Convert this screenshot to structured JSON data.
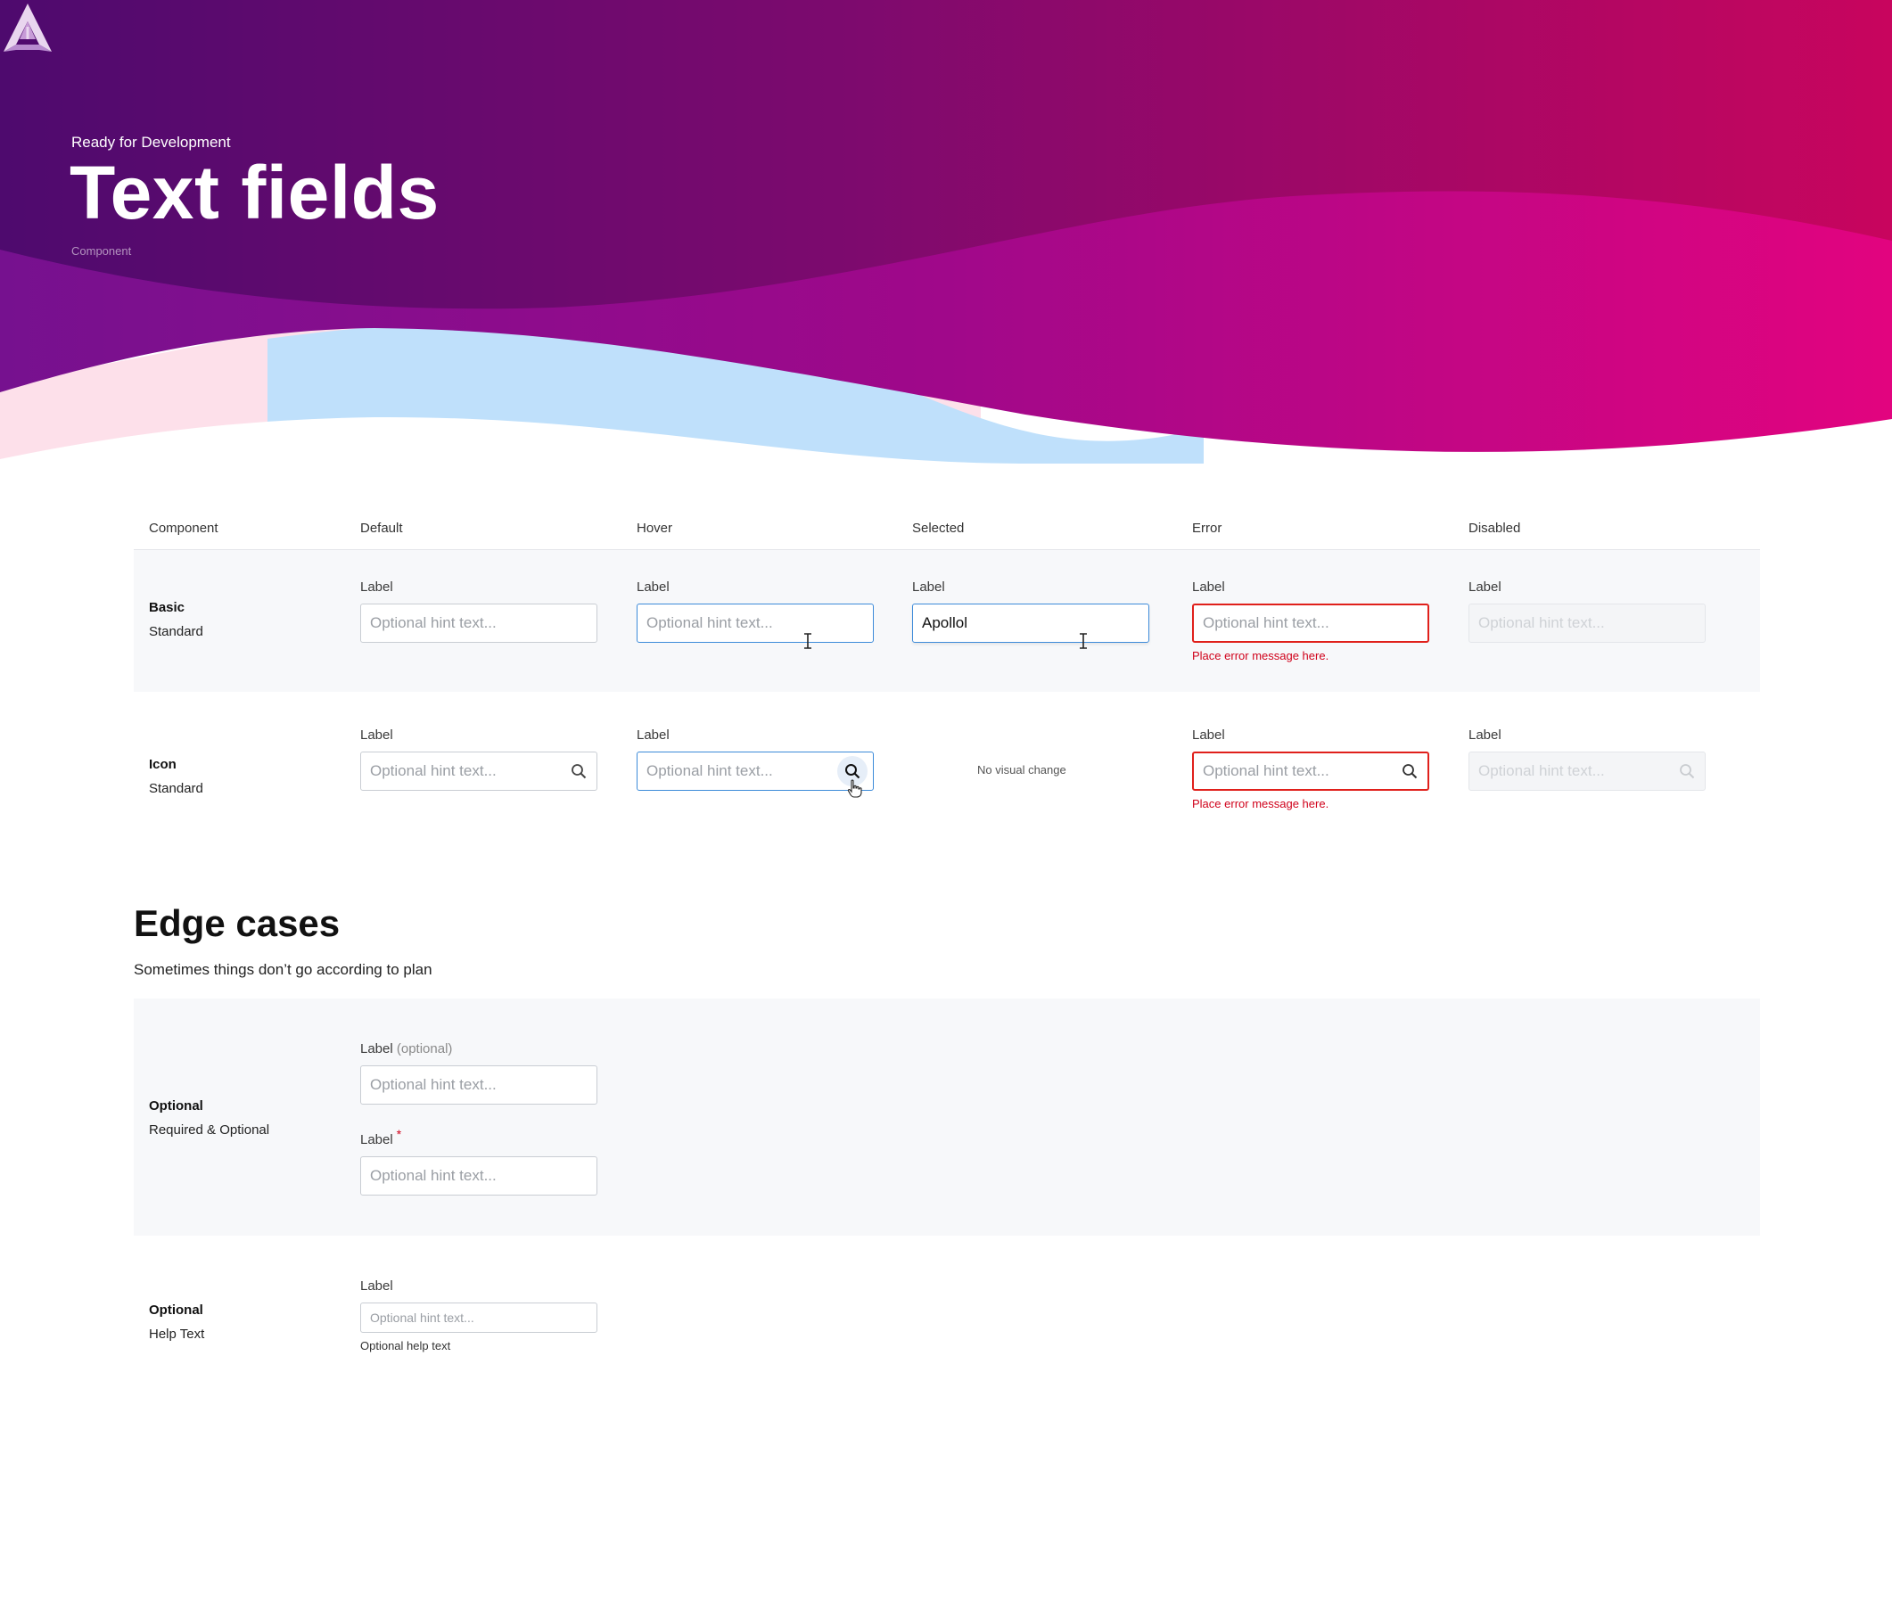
{
  "header": {
    "status": "Ready for Development",
    "title": "Text fields",
    "kind": "Component"
  },
  "table": {
    "columns": [
      "Component",
      "Default",
      "Hover",
      "Selected",
      "Error",
      "Disabled"
    ],
    "basic": {
      "name": "Basic",
      "sub": "Standard",
      "label": "Label",
      "hint": "Optional hint text...",
      "selected_value": "Apollol",
      "error_message": "Place error message here."
    },
    "icon": {
      "name": "Icon",
      "sub": "Standard",
      "label": "Label",
      "hint": "Optional hint text...",
      "no_change": "No visual change",
      "error_message": "Place error message here.",
      "icon_name": "search-icon"
    }
  },
  "edge": {
    "title": "Edge cases",
    "subtitle": "Sometimes things don’t go according to plan",
    "optional_row": {
      "name": "Optional",
      "sub": "Required & Optional",
      "label": "Label",
      "optional_tag": "(optional)",
      "required_mark": "*",
      "hint": "Optional hint text..."
    },
    "help_row": {
      "name": "Optional",
      "sub": "Help Text",
      "label": "Label",
      "hint": "Optional hint text...",
      "help": "Optional help text"
    }
  },
  "colors": {
    "focus": "#3d8bd9",
    "error": "#e0201b",
    "hero_from": "#4a0b6e",
    "hero_to": "#e0057f"
  }
}
